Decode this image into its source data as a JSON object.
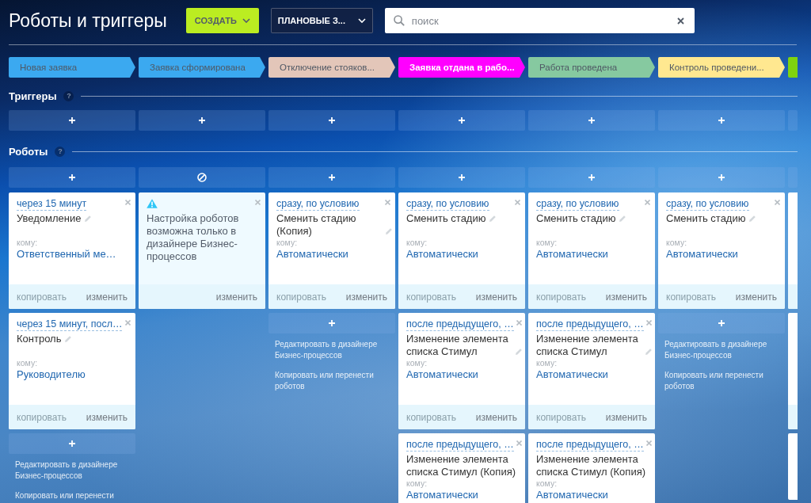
{
  "header": {
    "title": "Роботы и триггеры",
    "create_button": "СОЗДАТЬ",
    "plan_dropdown": "ПЛАНОВЫЕ З...",
    "search": {
      "placeholder": "поиск"
    }
  },
  "sections": {
    "triggers": {
      "title": "Триггеры",
      "help": "?"
    },
    "robots": {
      "title": "Роботы",
      "help": "?"
    }
  },
  "columns": [
    {
      "cut_off": false,
      "stage": {
        "label": "Новая заявка",
        "color": "#3ba9f0"
      },
      "robot_button": {
        "kind": "add"
      },
      "cards": [
        {
          "kind": "robot",
          "condition": "через 15 минут",
          "name": "Уведомление",
          "edit_icon": true,
          "recipient_label": "кому:",
          "recipient": "Ответственный ме…",
          "copy": {
            "label": "копировать",
            "disabled": true
          },
          "edit": "изменить"
        },
        {
          "kind": "robot",
          "condition": "через 15 минут, посл…",
          "name": "Контроль",
          "edit_icon": true,
          "recipient_label": "кому:",
          "recipient": "Руководителю",
          "copy": {
            "label": "копировать",
            "disabled": true
          },
          "edit": "изменить"
        }
      ],
      "tools": {
        "designer_link": "Редактировать в дизайнере Бизнес-процессов",
        "copy_link": "Копировать или перенести"
      }
    },
    {
      "cut_off": false,
      "stage": {
        "label": "Заявка сформирована",
        "color": "#3ba9f0"
      },
      "robot_button": {
        "kind": "blocked"
      },
      "cards": [
        {
          "kind": "notice",
          "message": "Настройка роботов возможна только в дизайнере Бизнес-процессов",
          "edit": "изменить"
        }
      ]
    },
    {
      "cut_off": false,
      "stage": {
        "label": "Отключение стояков...",
        "color": "#e3c6b9"
      },
      "robot_button": {
        "kind": "add"
      },
      "cards": [
        {
          "kind": "robot",
          "condition": "сразу, по условию",
          "name": "Сменить стадию (Копия)",
          "edit_icon": true,
          "recipient_label": "кому:",
          "recipient": "Автоматически",
          "copy": {
            "label": "копировать",
            "disabled": true
          },
          "edit": "изменить"
        }
      ],
      "tools": {
        "designer_link": "Редактировать в дизайнере Бизнес-процессов",
        "copy_link": "Копировать или перенести роботов"
      }
    },
    {
      "cut_off": false,
      "stage": {
        "label": "Заявка отдана в рабо...",
        "color": "#ff00ff"
      },
      "robot_button": {
        "kind": "add"
      },
      "cards": [
        {
          "kind": "robot",
          "condition": "сразу, по условию",
          "name": "Сменить стадию",
          "edit_icon": true,
          "recipient_label": "кому:",
          "recipient": "Автоматически",
          "copy": {
            "label": "копировать",
            "disabled": true
          },
          "edit": "изменить"
        },
        {
          "kind": "robot",
          "condition": "после предыдущего, …",
          "name": "Изменение элемента списка Стимул",
          "edit_icon": true,
          "recipient_label": "кому:",
          "recipient": "Автоматически",
          "copy": {
            "label": "копировать",
            "disabled": true
          },
          "edit": "изменить"
        },
        {
          "kind": "robot",
          "condition": "после предыдущего, …",
          "name": "Изменение элемента списка Стимул (Копия)",
          "edit_icon": false,
          "recipient_label": "кому:",
          "recipient": "Автоматически"
        }
      ]
    },
    {
      "cut_off": false,
      "stage": {
        "label": "Работа проведена",
        "color": "#86c9a0"
      },
      "robot_button": {
        "kind": "add"
      },
      "cards": [
        {
          "kind": "robot",
          "condition": "сразу, по условию",
          "name": "Сменить стадию",
          "edit_icon": true,
          "recipient_label": "кому:",
          "recipient": "Автоматически",
          "copy": {
            "label": "копировать",
            "disabled": true
          },
          "edit": "изменить"
        },
        {
          "kind": "robot",
          "condition": "после предыдущего, …",
          "name": "Изменение элемента списка Стимул",
          "edit_icon": true,
          "recipient_label": "кому:",
          "recipient": "Автоматически",
          "copy": {
            "label": "копировать",
            "disabled": true
          },
          "edit": "изменить"
        },
        {
          "kind": "robot",
          "condition": "после предыдущего, …",
          "name": "Изменение элемента списка Стимул (Копия)",
          "edit_icon": false,
          "recipient_label": "кому:",
          "recipient": "Автоматически"
        }
      ]
    },
    {
      "cut_off": false,
      "stage": {
        "label": "Контроль проведени...",
        "color": "#ffe890"
      },
      "robot_button": {
        "kind": "add"
      },
      "cards": [
        {
          "kind": "robot",
          "condition": "сразу, по условию",
          "name": "Сменить стадию",
          "edit_icon": true,
          "recipient_label": "кому:",
          "recipient": "Автоматически",
          "copy": {
            "label": "копировать",
            "disabled": true
          },
          "edit": "изменить"
        }
      ],
      "tools": {
        "designer_link": "Редактировать в дизайнере Бизнес-процессов",
        "copy_link": "Копировать или перенести роботов"
      }
    },
    {
      "cut_off": true,
      "stage": {
        "color": "#7fd30f"
      },
      "cards": [
        {
          "kind": "stub",
          "footer": true
        },
        {
          "kind": "stub",
          "footer": true
        },
        {
          "kind": "stub",
          "footer": false
        }
      ]
    }
  ]
}
